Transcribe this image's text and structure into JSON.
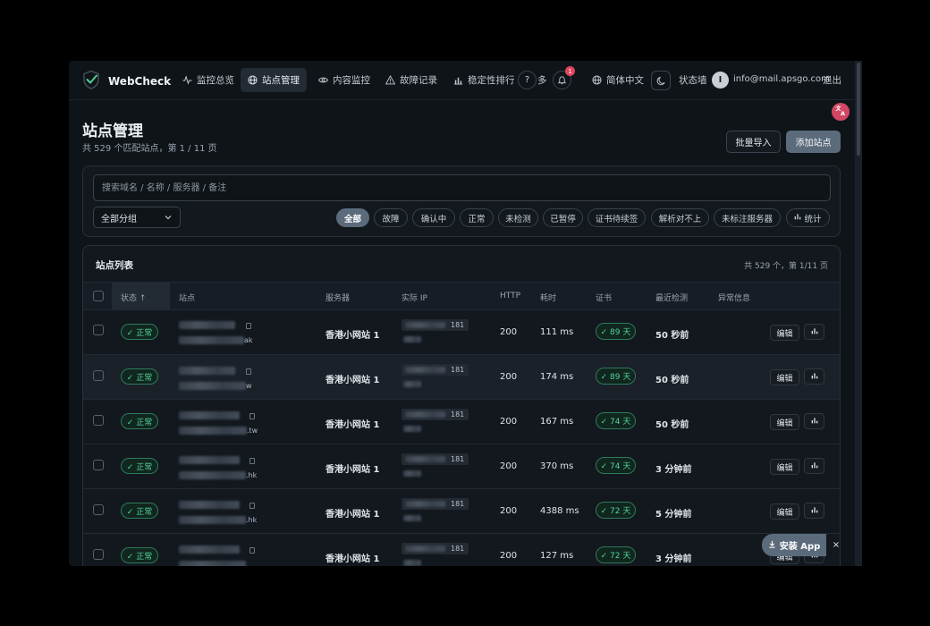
{
  "topbar": {
    "brand": "WebCheck",
    "nav": [
      {
        "label": "监控总览",
        "icon": "activity-icon"
      },
      {
        "label": "站点管理",
        "icon": "globe-icon",
        "active": true
      },
      {
        "label": "内容监控",
        "icon": "eye-icon"
      },
      {
        "label": "故障记录",
        "icon": "alert-triangle-icon"
      },
      {
        "label": "稳定性排行",
        "icon": "bar-chart-icon"
      }
    ],
    "more_label": "多",
    "notification_count": "1",
    "language": "简体中文",
    "status_wall": "状态墙",
    "avatar_initial": "I",
    "email": "info@mail.apsgo.com",
    "logout": "退出"
  },
  "page": {
    "title": "站点管理",
    "subtitle": "共 529 个匹配站点，第 1 / 11 页",
    "bulk_import": "批量导入",
    "add_site": "添加站点"
  },
  "filters": {
    "search_placeholder": "搜索域名 / 名称 / 服务器 / 备注",
    "group_select": "全部分组",
    "chips": [
      "全部",
      "故障",
      "确认中",
      "正常",
      "未检测",
      "已暂停",
      "证书待续签",
      "解析对不上",
      "未标注服务器",
      "统计"
    ]
  },
  "table": {
    "title": "站点列表",
    "count": "共 529 个，第 1/11 页",
    "headers": [
      "状态 ↑",
      "站点",
      "服务器",
      "实际 IP",
      "HTTP",
      "耗时",
      "证书",
      "最近检测",
      "异常信息"
    ],
    "edit_label": "编辑",
    "rows": [
      {
        "status": "✓ 正常",
        "tail": "ak",
        "server": "香港小网站 1",
        "ip": "181",
        "http": "200",
        "ms": "111 ms",
        "cert": "✓ 89 天",
        "last": "50 秒前"
      },
      {
        "status": "✓ 正常",
        "tail": "w",
        "server": "香港小网站 1",
        "ip": "181",
        "http": "200",
        "ms": "174 ms",
        "cert": "✓ 89 天",
        "last": "50 秒前"
      },
      {
        "status": "✓ 正常",
        "tail": ".tw",
        "server": "香港小网站 1",
        "ip": "181",
        "http": "200",
        "ms": "167 ms",
        "cert": "✓ 74 天",
        "last": "50 秒前"
      },
      {
        "status": "✓ 正常",
        "tail": ".hk",
        "server": "香港小网站 1",
        "ip": "181",
        "http": "200",
        "ms": "370 ms",
        "cert": "✓ 74 天",
        "last": "3 分钟前"
      },
      {
        "status": "✓ 正常",
        "tail": ".hk",
        "server": "香港小网站 1",
        "ip": "181",
        "http": "200",
        "ms": "4388 ms",
        "cert": "✓ 72 天",
        "last": "5 分钟前"
      },
      {
        "status": "✓ 正常",
        "tail": "",
        "server": "香港小网站 1",
        "ip": "181",
        "http": "200",
        "ms": "127 ms",
        "cert": "✓ 72 天",
        "last": "3 分钟前"
      }
    ]
  },
  "install": {
    "label": "安装 App",
    "close": "×"
  },
  "colors": {
    "accent": "#5b6b7b",
    "ok_green": "#53d39b",
    "badge_red": "#e0455a",
    "fab_pink": "#d24765"
  }
}
